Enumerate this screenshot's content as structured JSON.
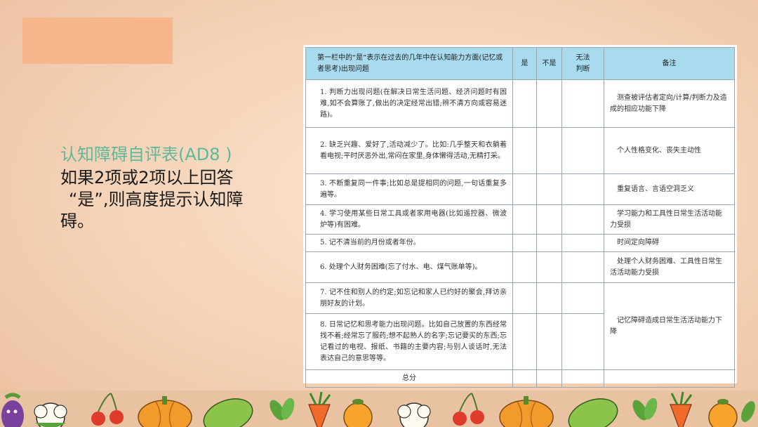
{
  "left": {
    "title": "认知障碍自评表(AD8 )",
    "lines": [
      "如果2项或2项以上回答",
      "“是”,则高度提示认知障",
      "碍。"
    ]
  },
  "table": {
    "headers": {
      "question": "第一栏中的“是”表示在过去的几年中在认知能力方面(记忆或者思考)出现问题",
      "yes": "是",
      "no": "不是",
      "unable_1": "无法",
      "unable_2": "判断",
      "remark": "备注"
    },
    "rows": [
      {
        "q": "1. 判断力出现问题(在解决日常生活问题、经济问题时有困难,如不会算账了,做出的决定经常出错;辨不清方向或容易迷路)。",
        "note": "测查被评估者定向/计算/判断力及造成的相应功能下降"
      },
      {
        "q": "2. 缺乏兴趣、爱好了,活动减少了。比如:几乎整天和衣躺着看电视;平时厌恶外出,常闷在家里,身体懒得活动,无精打采。",
        "note": "个人性格变化、丧失主动性"
      },
      {
        "q": "3. 不断重复同一件事;比如总是提相同的问题,一句话重复多遍等。",
        "note": "重复语言、言语空洞乏义"
      },
      {
        "q": "4. 学习使用某些日常工具或者家用电器(比如遥控器、微波炉等)有困难。",
        "note": "学习能力和工具性日常生活活动能力受损"
      },
      {
        "q": "5. 记不清当前的月份或者年份。",
        "note": "时间定向障碍"
      },
      {
        "q": "6. 处理个人财务困难(忘了付水、电、煤气账单等)。",
        "note": "处理个人财务困难、工具性日常生活活动能力受损"
      },
      {
        "q": "7. 记不住和别人的约定;如忘记和家人已约好的聚会,拜访亲朋好友的计划。"
      },
      {
        "q": "8. 日常记忆和思考能力出现问题。比如自己放置的东西经常找不着;经常忘了服药;想不起熟人的名字;忘记要买的东西;忘记看过的电视、报纸、书籍的主要内容;与别人谈话时,无法表达自己的意思等等。"
      }
    ],
    "merged_note": "记忆障碍造成日常生活活动能力下降",
    "total_label": "总分"
  },
  "colors": {
    "accent_block": "#f7b58c",
    "title_green": "#5fb89c",
    "header_blue": "#a9dbef"
  }
}
